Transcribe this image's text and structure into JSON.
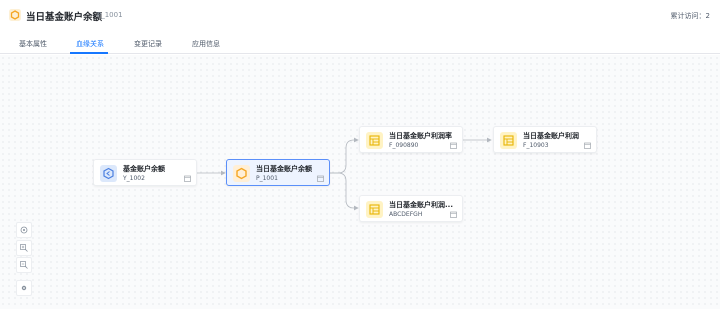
{
  "header": {
    "title": "当日基金账户余额",
    "code": "P_1001",
    "visit_count": "累计访问：2",
    "icon": "hexagon-logo-icon",
    "accent_color": "#f5a623"
  },
  "tabs": [
    {
      "label": "基本属性",
      "active": false
    },
    {
      "label": "血缘关系",
      "active": true
    },
    {
      "label": "变更记录",
      "active": false
    },
    {
      "label": "应用信息",
      "active": false
    }
  ],
  "graph": {
    "nodes": [
      {
        "id": "n1",
        "title": "基金账户余额",
        "code": "Y_1002",
        "icon": "hexagon-blue-icon"
      },
      {
        "id": "n2",
        "title": "当日基金账户余额",
        "code": "P_1001",
        "icon": "hexagon-orange-icon",
        "selected": true
      },
      {
        "id": "n3",
        "title": "当日基金账户利润率",
        "code": "F_090890",
        "icon": "table-yellow-icon"
      },
      {
        "id": "n4",
        "title": "当日基金账户利润",
        "code": "F_10903",
        "icon": "table-yellow-icon"
      },
      {
        "id": "n5",
        "title": "当日基金账户利润...",
        "code": "ABCDEFGH",
        "icon": "table-yellow-icon"
      }
    ],
    "edges": [
      {
        "from": "n1",
        "to": "n2"
      },
      {
        "from": "n2",
        "to": "n3"
      },
      {
        "from": "n2",
        "to": "n5"
      },
      {
        "from": "n3",
        "to": "n4"
      }
    ]
  },
  "toolbar": {
    "icons": [
      "locate-icon",
      "zoom-in-icon",
      "zoom-out-icon",
      "settings-icon"
    ]
  }
}
